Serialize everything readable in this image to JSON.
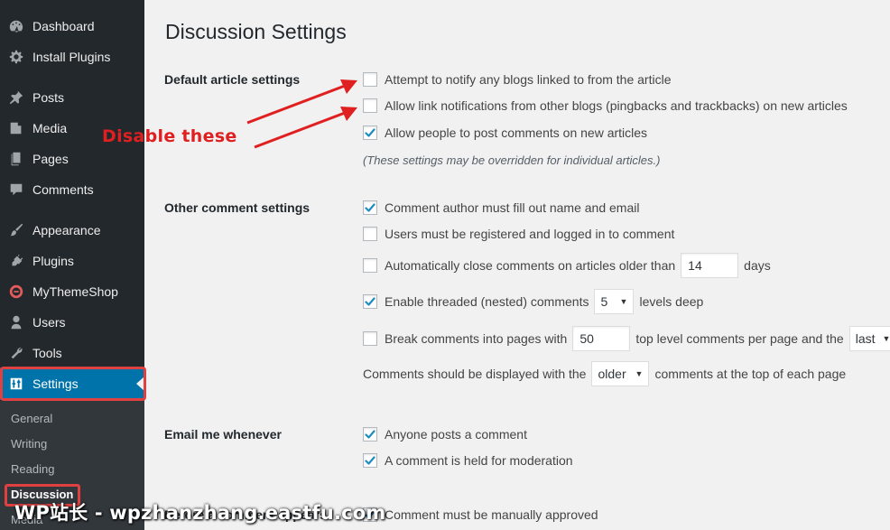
{
  "sidebar": {
    "items": [
      {
        "label": "Dashboard",
        "icon": "dashboard-icon"
      },
      {
        "label": "Install Plugins",
        "icon": "gear-icon"
      },
      {
        "label": "Posts",
        "icon": "pushpin-icon"
      },
      {
        "label": "Media",
        "icon": "media-icon"
      },
      {
        "label": "Pages",
        "icon": "pages-icon"
      },
      {
        "label": "Comments",
        "icon": "speech-bubble-icon"
      },
      {
        "label": "Appearance",
        "icon": "paintbrush-icon"
      },
      {
        "label": "Plugins",
        "icon": "plug-icon"
      },
      {
        "label": "MyThemeShop",
        "icon": "mythemeshop-icon"
      },
      {
        "label": "Users",
        "icon": "user-icon"
      },
      {
        "label": "Tools",
        "icon": "wrench-icon"
      },
      {
        "label": "Settings",
        "icon": "settings-sliders-icon"
      }
    ],
    "submenu": [
      "General",
      "Writing",
      "Reading",
      "Discussion",
      "Media"
    ],
    "active_item": "Settings",
    "active_submenu": "Discussion",
    "active_color": "#0073aa"
  },
  "page": {
    "title": "Discussion Settings",
    "annotation": "Disable these",
    "annotation_color": "#e02020"
  },
  "default_article": {
    "label": "Default article settings",
    "options": [
      {
        "label": "Attempt to notify any blogs linked to from the article",
        "checked": false
      },
      {
        "label": "Allow link notifications from other blogs (pingbacks and trackbacks) on new articles",
        "checked": false
      },
      {
        "label": "Allow people to post comments on new articles",
        "checked": true
      }
    ],
    "note": "(These settings may be overridden for individual articles.)"
  },
  "other_comment": {
    "label": "Other comment settings",
    "author_fill": {
      "label": "Comment author must fill out name and email",
      "checked": true
    },
    "registered": {
      "label": "Users must be registered and logged in to comment",
      "checked": false
    },
    "auto_close": {
      "label": "Automatically close comments on articles older than",
      "value": "14",
      "suffix": "days",
      "checked": false
    },
    "threaded": {
      "label": "Enable threaded (nested) comments",
      "value": "5",
      "suffix": "levels deep",
      "checked": true
    },
    "paged": {
      "label": "Break comments into pages with",
      "value": "50",
      "middle": "top level comments per page and the",
      "select_value": "last",
      "checked": false
    },
    "order": {
      "prefix": "Comments should be displayed with the",
      "select_value": "older",
      "suffix": "comments at the top of each page"
    }
  },
  "email": {
    "label": "Email me whenever",
    "options": [
      {
        "label": "Anyone posts a comment",
        "checked": true
      },
      {
        "label": "A comment is held for moderation",
        "checked": true
      }
    ]
  },
  "before_appears": {
    "label": "Before a comment appears",
    "option": {
      "label": "Comment must be manually approved",
      "checked": true
    }
  },
  "watermark": "WP站长 - wpzhanzhang.eastfu.com"
}
